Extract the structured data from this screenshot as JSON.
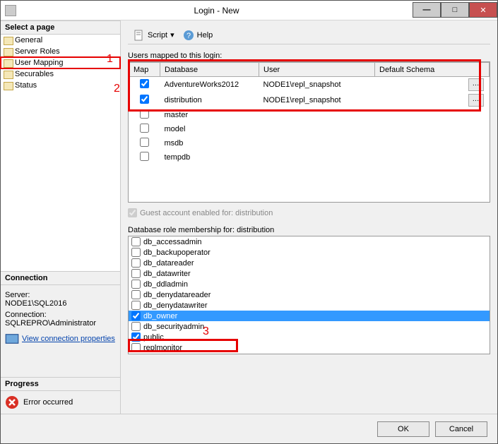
{
  "window": {
    "title": "Login - New"
  },
  "sidebar": {
    "select_header": "Select a page",
    "pages": [
      "General",
      "Server Roles",
      "User Mapping",
      "Securables",
      "Status"
    ],
    "connection_header": "Connection",
    "server_label": "Server:",
    "server_value": "NODE1\\SQL2016",
    "connection_label": "Connection:",
    "connection_value": "SQLREPRO\\Administrator",
    "view_link": "View connection properties",
    "progress_header": "Progress",
    "progress_text": "Error occurred"
  },
  "toolbar": {
    "script": "Script",
    "help": "Help"
  },
  "main": {
    "mapped_label": "Users mapped to this login:",
    "columns": {
      "map": "Map",
      "database": "Database",
      "user": "User",
      "schema": "Default Schema"
    },
    "rows": [
      {
        "checked": true,
        "db": "AdventureWorks2012",
        "user": "NODE1\\repl_snapshot",
        "btn": true
      },
      {
        "checked": true,
        "db": "distribution",
        "user": "NODE1\\repl_snapshot",
        "btn": true
      },
      {
        "checked": false,
        "db": "master",
        "user": "",
        "btn": false
      },
      {
        "checked": false,
        "db": "model",
        "user": "",
        "btn": false
      },
      {
        "checked": false,
        "db": "msdb",
        "user": "",
        "btn": false
      },
      {
        "checked": false,
        "db": "tempdb",
        "user": "",
        "btn": false
      }
    ],
    "guest_label": "Guest account enabled for: distribution",
    "roles_label": "Database role membership for: distribution",
    "roles": [
      {
        "name": "db_accessadmin",
        "checked": false
      },
      {
        "name": "db_backupoperator",
        "checked": false
      },
      {
        "name": "db_datareader",
        "checked": false
      },
      {
        "name": "db_datawriter",
        "checked": false
      },
      {
        "name": "db_ddladmin",
        "checked": false
      },
      {
        "name": "db_denydatareader",
        "checked": false
      },
      {
        "name": "db_denydatawriter",
        "checked": false
      },
      {
        "name": "db_owner",
        "checked": true,
        "selected": true
      },
      {
        "name": "db_securityadmin",
        "checked": false
      },
      {
        "name": "public",
        "checked": true
      },
      {
        "name": "replmonitor",
        "checked": false
      }
    ]
  },
  "annotations": {
    "a1": "1",
    "a2": "2",
    "a3": "3"
  },
  "footer": {
    "ok": "OK",
    "cancel": "Cancel"
  }
}
